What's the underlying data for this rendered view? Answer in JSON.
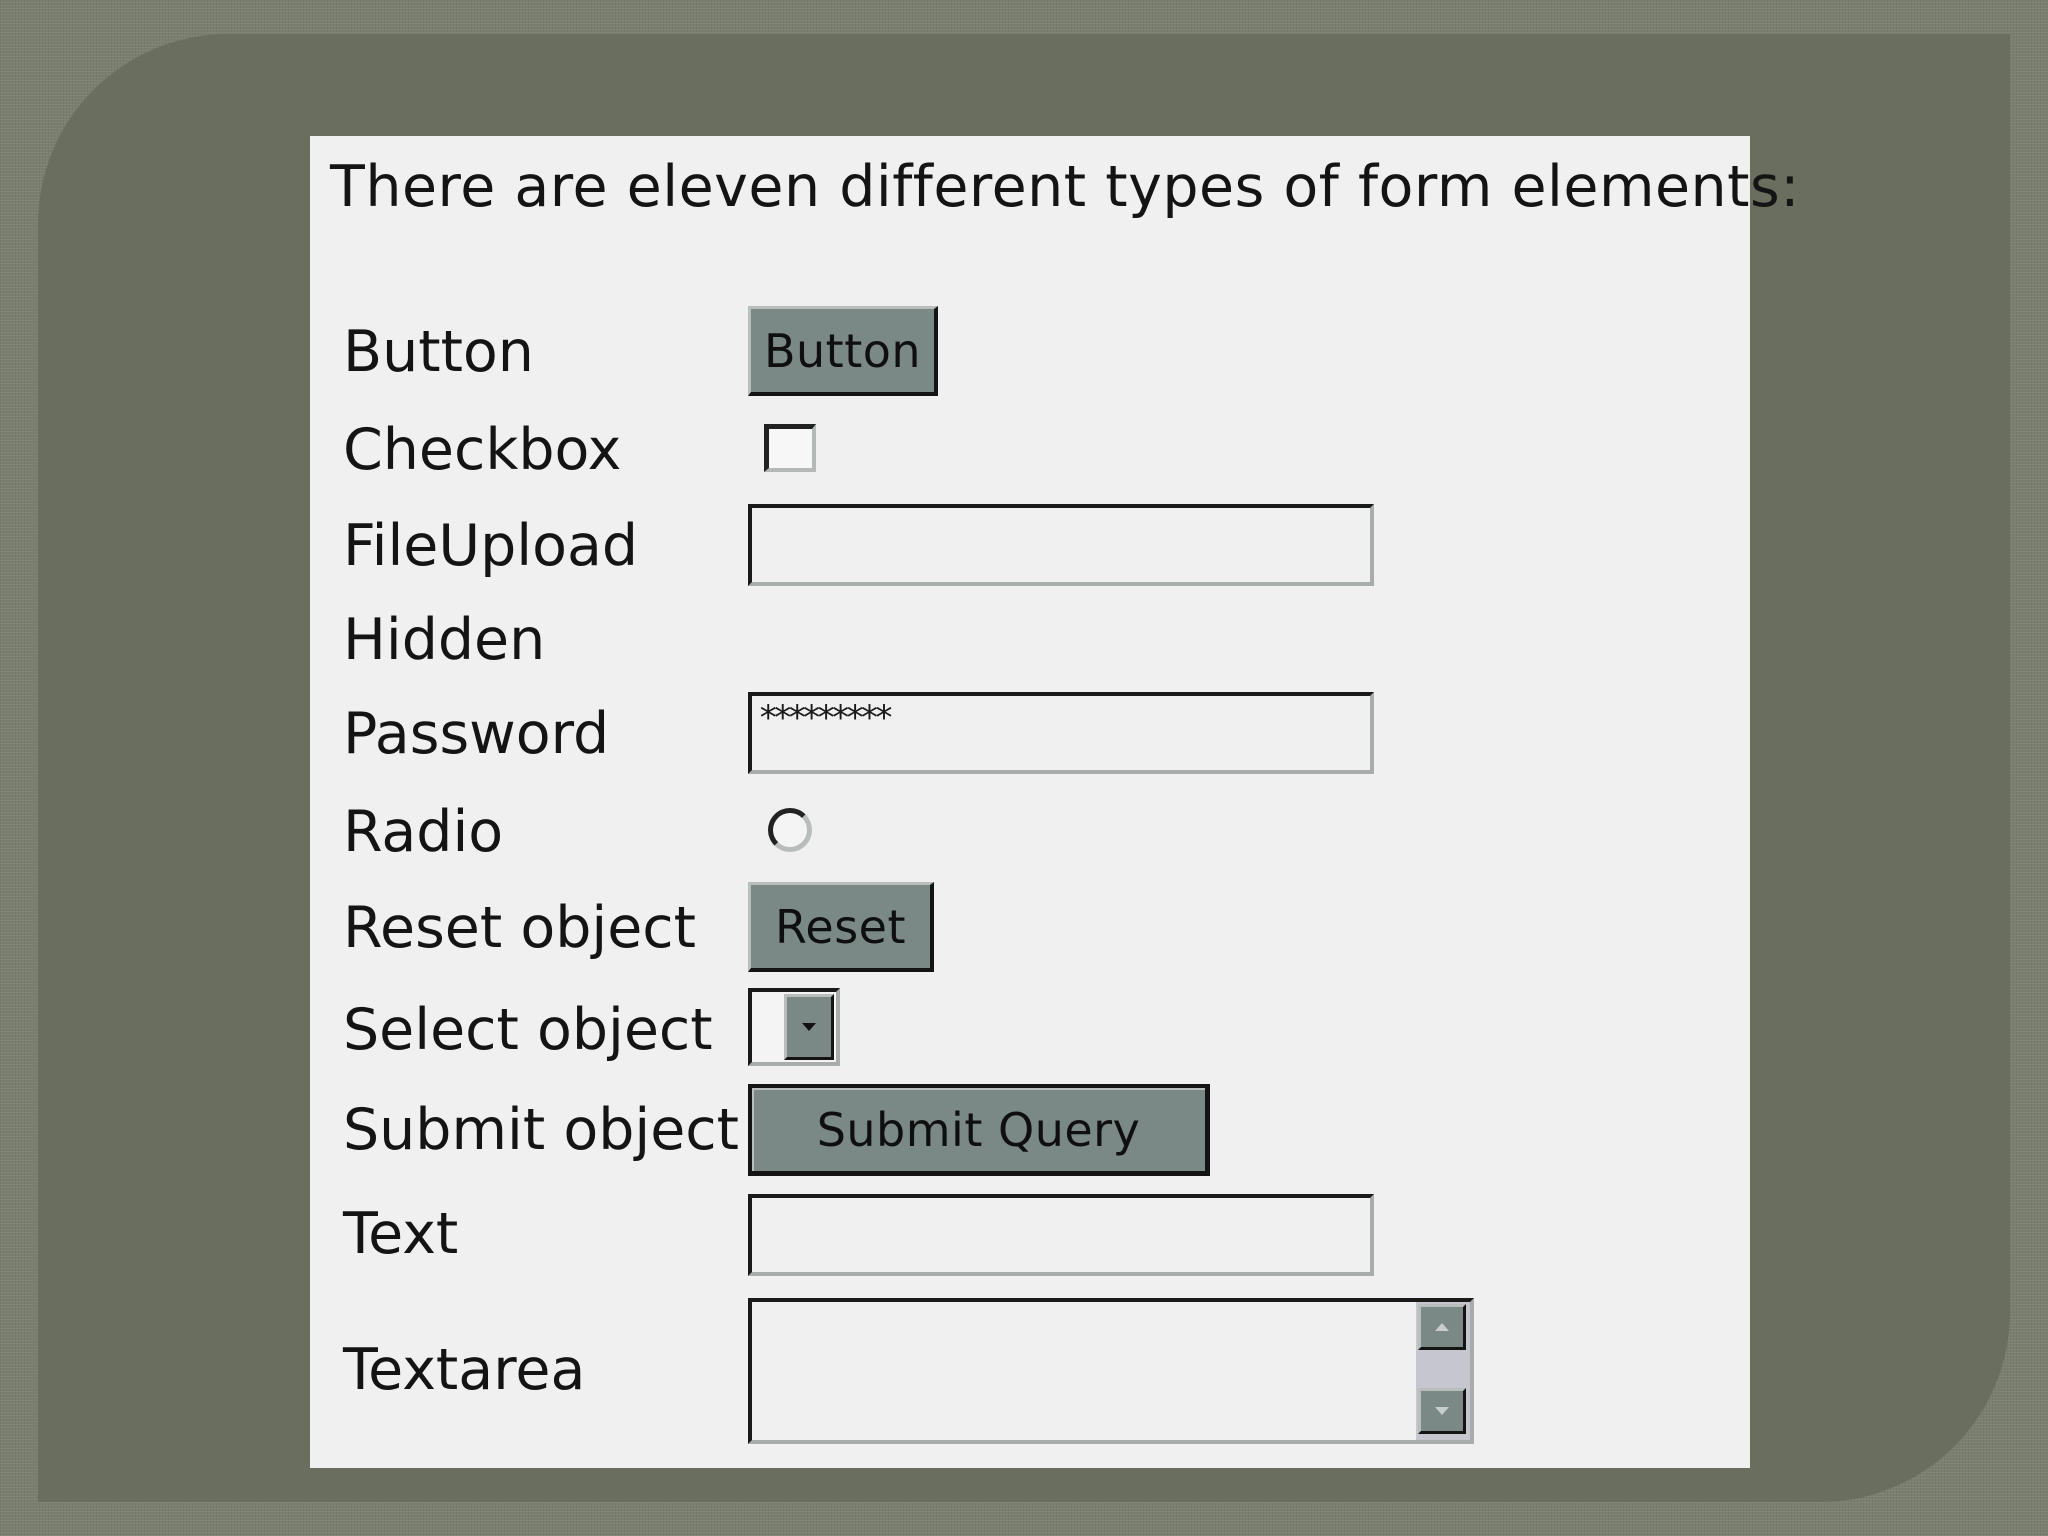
{
  "heading": "There are eleven different types of form elements:",
  "rows": [
    {
      "label": "Button"
    },
    {
      "label": "Checkbox"
    },
    {
      "label": "FileUpload"
    },
    {
      "label": "Hidden"
    },
    {
      "label": "Password"
    },
    {
      "label": "Radio"
    },
    {
      "label": "Reset object"
    },
    {
      "label": "Select object"
    },
    {
      "label": "Submit object"
    },
    {
      "label": "Text"
    },
    {
      "label": "Textarea"
    }
  ],
  "controls": {
    "button_label": "Button",
    "password_value": "*********",
    "reset_label": "Reset",
    "submit_label": "Submit Query",
    "select_arrow_icon": "chevron-down-icon",
    "scroll_up_icon": "arrow-up-icon",
    "scroll_down_icon": "arrow-down-icon"
  },
  "colors": {
    "background": "#7b7f6f",
    "slide": "#6a6e5e",
    "panel": "#eff0ef",
    "button_face": "#7a8886"
  }
}
